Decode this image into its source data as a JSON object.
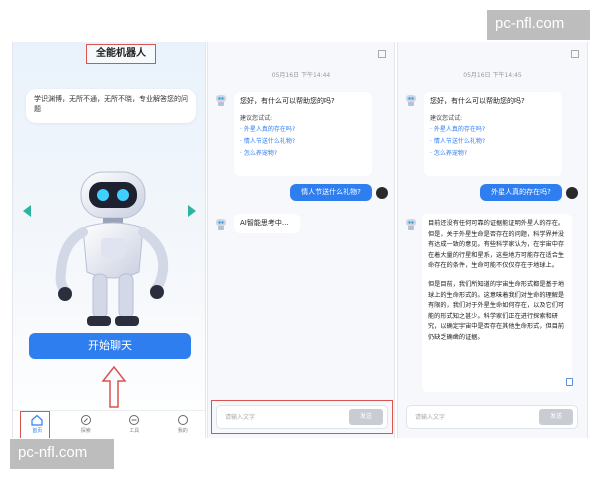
{
  "watermark": {
    "text": "pc-nfl.com"
  },
  "home": {
    "title": "全能机器人",
    "intro": "学识渊博，无所不通，无所不晓，专业解答您的问题",
    "start_button": "开始聊天",
    "tabs": [
      {
        "label": "首页",
        "icon": "home-icon"
      },
      {
        "label": "探索",
        "icon": "compass-icon"
      },
      {
        "label": "工具",
        "icon": "tool-icon"
      },
      {
        "label": "我的",
        "icon": "user-icon"
      }
    ],
    "accent": "#2f7ef0",
    "highlight": "#d9534f"
  },
  "chat1": {
    "timestamp": "05月16日 下午14:44",
    "greeting": "您好，有什么可以帮助您的吗?",
    "suggest_title": "建议您试试:",
    "suggestions": [
      "· 外星人真的存在吗?",
      "· 情人节送什么礼物?",
      "· 怎么养宠物?"
    ],
    "user_msg": "情人节送什么礼物?",
    "thinking": "AI智能思考中...",
    "input_placeholder": "请输入文字",
    "send_label": "发送"
  },
  "chat2": {
    "timestamp": "05月16日 下午14:45",
    "greeting": "您好，有什么可以帮助您的吗?",
    "suggest_title": "建议您试试:",
    "suggestions": [
      "· 外星人真的存在吗?",
      "· 情人节送什么礼物?",
      "· 怎么养宠物?"
    ],
    "user_msg": "外星人真的存在吗?",
    "answer_p1": "目前还没有任何可靠的证据能证明外星人的存在。但是，关于外星生命是否存在的问题，科学界并没有达成一致的意见。有些科学家认为，在宇宙中存在着大量的行星和星系，这些地方可能存在适合生命存在的条件，生命可能不仅仅存在于地球上。",
    "answer_p2": "但是目前，我们所知道的宇宙生命形式都是基于地球上的生命形式的。这意味着我们对生命的理解是有限的，我们对于外星生命如何存在，以及它们可能的形式知之甚少。科学家们正在进行探索和研究，以确定宇宙中是否存在其他生命形式，但目前仍缺乏确凿的证据。",
    "input_placeholder": "请输入文字",
    "send_label": "发送"
  }
}
